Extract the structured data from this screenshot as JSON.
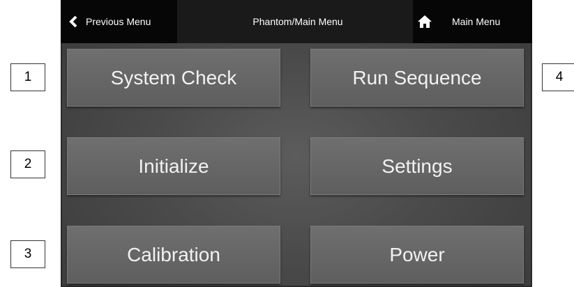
{
  "callouts": [
    "1",
    "2",
    "3",
    "4"
  ],
  "header": {
    "previous_label": "Previous Menu",
    "title": "Phantom/Main Menu",
    "main_menu_label": "Main Menu"
  },
  "buttons": {
    "system_check": "System Check",
    "run_sequence": "Run Sequence",
    "initialize": "Initialize",
    "settings": "Settings",
    "calibration": "Calibration",
    "power": "Power"
  },
  "icons": {
    "previous": "chevron-left-icon",
    "main_menu": "home-icon"
  }
}
